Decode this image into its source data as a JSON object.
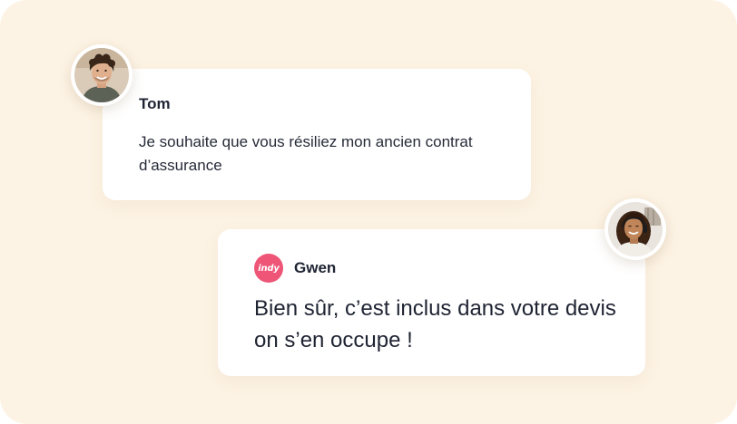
{
  "messages": [
    {
      "sender": "Tom",
      "text": "Je souhaite que vous résiliez mon ancien contrat d’assurance"
    },
    {
      "sender": "Gwen",
      "brand_logo_text": "indy",
      "text": "Bien sûr, c’est inclus dans votre devis on s’en occupe !"
    }
  ],
  "colors": {
    "background": "#fdf3e4",
    "card": "#ffffff",
    "brand": "#ee5577",
    "text": "#1f2433"
  }
}
